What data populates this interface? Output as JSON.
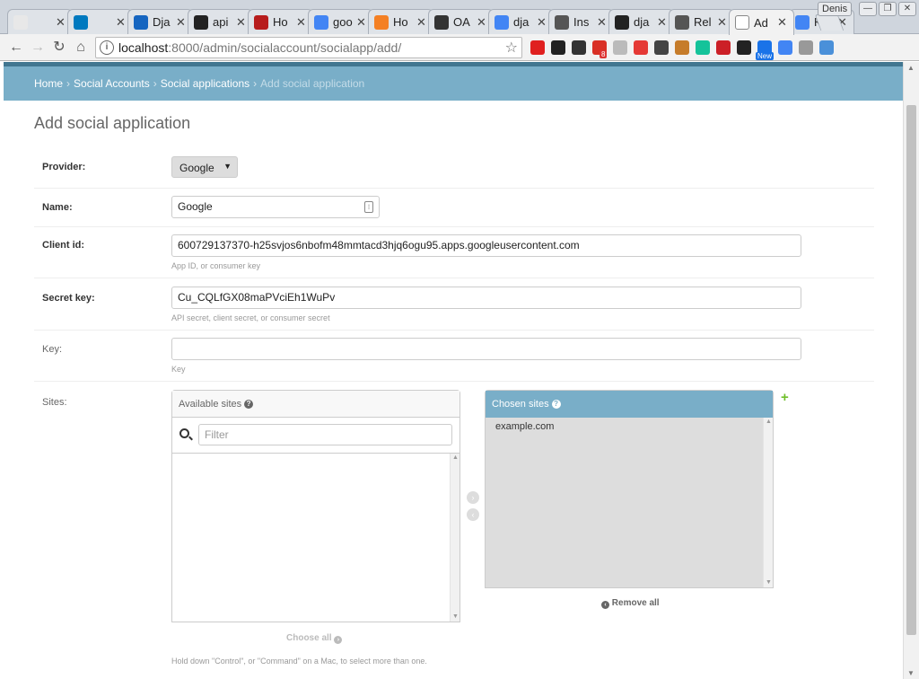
{
  "browser": {
    "profile_name": "Denis",
    "window_buttons": [
      "—",
      "❐",
      "✕"
    ],
    "tabs": [
      {
        "label": "",
        "icon": "refresh-g",
        "color": "#e8e8e8"
      },
      {
        "label": "",
        "icon": "trello",
        "color": "#0079bf"
      },
      {
        "label": "Dja",
        "icon": "layers",
        "color": "#1565c0"
      },
      {
        "label": "api",
        "icon": "github",
        "color": "#222222"
      },
      {
        "label": "Ho",
        "icon": "ho",
        "color": "#b71c1c"
      },
      {
        "label": "goo",
        "icon": "google",
        "color": "#4285f4"
      },
      {
        "label": "Ho",
        "icon": "stack",
        "color": "#f48024"
      },
      {
        "label": "OA",
        "icon": "github-cat",
        "color": "#333333"
      },
      {
        "label": "dja",
        "icon": "google",
        "color": "#4285f4"
      },
      {
        "label": "Ins",
        "icon": "doc",
        "color": "#555555"
      },
      {
        "label": "dja",
        "icon": "github",
        "color": "#222222"
      },
      {
        "label": "Rel",
        "icon": "doc",
        "color": "#555555"
      },
      {
        "label": "Ad",
        "icon": "page",
        "color": "#ffffff",
        "active": true
      },
      {
        "label": "Кл",
        "icon": "google",
        "color": "#4285f4"
      }
    ],
    "url_host": "localhost",
    "url_rest": ":8000/admin/socialaccount/socialapp/add/",
    "extensions": [
      {
        "name": "opera-icon",
        "color": "#e0201f"
      },
      {
        "name": "bird-icon",
        "color": "#222222"
      },
      {
        "name": "evernote-icon",
        "color": "#333333"
      },
      {
        "name": "gmail-icon",
        "color": "#d93025",
        "badge": "8"
      },
      {
        "name": "plus-icon",
        "color": "#bbbbbb"
      },
      {
        "name": "color-icon",
        "color": "#e53935"
      },
      {
        "name": "pocket-icon",
        "color": "#444444"
      },
      {
        "name": "hammer-icon",
        "color": "#c67c2a"
      },
      {
        "name": "grammarly-icon",
        "color": "#15c39a"
      },
      {
        "name": "lastpass-icon",
        "color": "#cc2027"
      },
      {
        "name": "gnome-icon",
        "color": "#222222"
      },
      {
        "name": "screen-icon",
        "color": "#1a73e8",
        "badge": "New"
      },
      {
        "name": "translate-icon",
        "color": "#4285f4"
      },
      {
        "name": "person-icon",
        "color": "#999999"
      },
      {
        "name": "robot-icon",
        "color": "#4a90d9"
      }
    ]
  },
  "breadcrumbs": {
    "home": "Home",
    "app": "Social Accounts",
    "model": "Social applications",
    "current": "Add social application",
    "sep": "›"
  },
  "title": "Add social application",
  "form": {
    "provider": {
      "label": "Provider:",
      "value": "Google"
    },
    "name": {
      "label": "Name:",
      "value": "Google"
    },
    "client_id": {
      "label": "Client id:",
      "value": "600729137370-h25svjos6nbofm48mmtacd3hjq6ogu95.apps.googleusercontent.com",
      "help": "App ID, or consumer key"
    },
    "secret_key": {
      "label": "Secret key:",
      "value": "Cu_CQLfGX08maPVciEh1WuPv",
      "help": "API secret, client secret, or consumer secret"
    },
    "key": {
      "label": "Key:",
      "value": "",
      "help": "Key"
    },
    "sites": {
      "label": "Sites:",
      "available_title": "Available sites",
      "filter_placeholder": "Filter",
      "available": [],
      "chosen_title": "Chosen sites",
      "chosen": [
        "example.com"
      ],
      "choose_all": "Choose all",
      "remove_all": "Remove all",
      "help": "Hold down \"Control\", or \"Command\" on a Mac, to select more than one."
    }
  },
  "colors": {
    "header": "#79aec8",
    "header_dark": "#417690",
    "add_green": "#70bf2b"
  }
}
